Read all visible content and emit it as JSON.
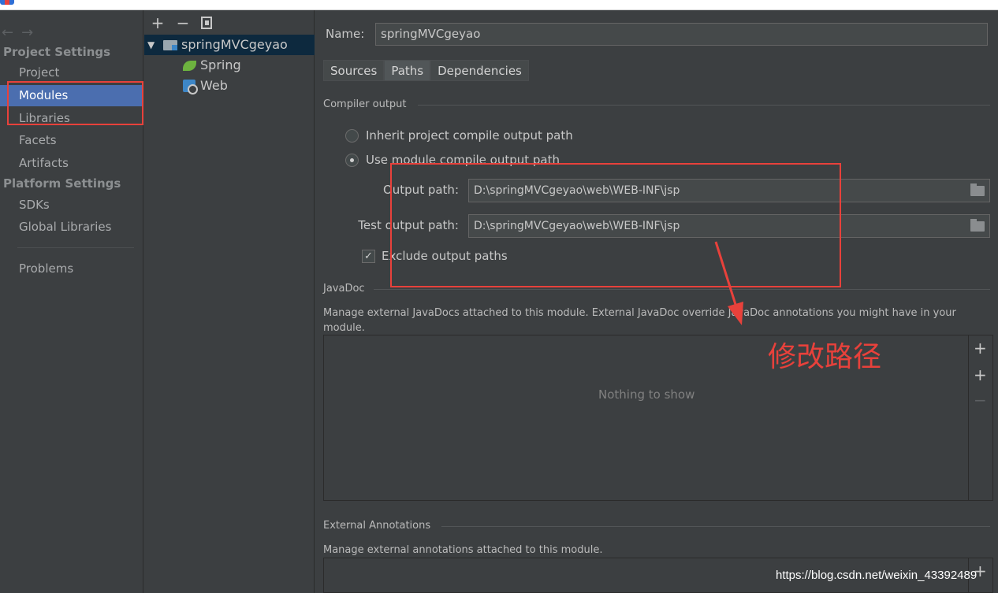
{
  "nav": {
    "project_settings_header": "Project Settings",
    "items_project": [
      {
        "label": "Project",
        "selected": false
      },
      {
        "label": "Modules",
        "selected": true
      },
      {
        "label": "Libraries",
        "selected": false
      },
      {
        "label": "Facets",
        "selected": false
      },
      {
        "label": "Artifacts",
        "selected": false
      }
    ],
    "platform_settings_header": "Platform Settings",
    "items_platform": [
      {
        "label": "SDKs"
      },
      {
        "label": "Global Libraries"
      }
    ],
    "problems_label": "Problems",
    "back_arrow": "←",
    "forward_arrow": "→"
  },
  "tree": {
    "toolbar": {
      "add": "+",
      "remove": "−"
    },
    "root": {
      "label": "springMVCgeyao",
      "expanded": true,
      "icon": "module-folder-icon"
    },
    "children": [
      {
        "label": "Spring",
        "icon": "spring-leaf-icon"
      },
      {
        "label": "Web",
        "icon": "web-facet-icon"
      }
    ]
  },
  "module": {
    "name_label": "Name:",
    "name_value": "springMVCgeyao",
    "tabs": [
      {
        "label": "Sources",
        "active": false
      },
      {
        "label": "Paths",
        "active": true
      },
      {
        "label": "Dependencies",
        "active": false
      }
    ]
  },
  "compiler_output": {
    "title": "Compiler output",
    "option_inherit": "Inherit project compile output path",
    "option_use_module": "Use module compile output path",
    "selected_option": "use_module",
    "output_path_label": "Output path:",
    "output_path_value": "D:\\springMVCgeyao\\web\\WEB-INF\\jsp",
    "test_output_path_label": "Test output path:",
    "test_output_path_value": "D:\\springMVCgeyao\\web\\WEB-INF\\jsp",
    "exclude_label": "Exclude output paths",
    "exclude_checked": true
  },
  "javadoc": {
    "title": "JavaDoc",
    "description": "Manage external JavaDocs attached to this module. External JavaDoc override JavaDoc annotations you might have in your module.",
    "empty_text": "Nothing to show",
    "tools": {
      "add": "+",
      "add_url": "+",
      "remove": "−"
    }
  },
  "external_annotations": {
    "title": "External Annotations",
    "description": "Manage external annotations attached to this module.",
    "tools": {
      "add": "+"
    }
  },
  "overlay": {
    "annotation_text": "修改路径",
    "watermark": "https://blog.csdn.net/weixin_43392489",
    "highlight_color": "#e8413b"
  },
  "colors": {
    "selection": "#4b6eaf",
    "background": "#3c3f41"
  }
}
